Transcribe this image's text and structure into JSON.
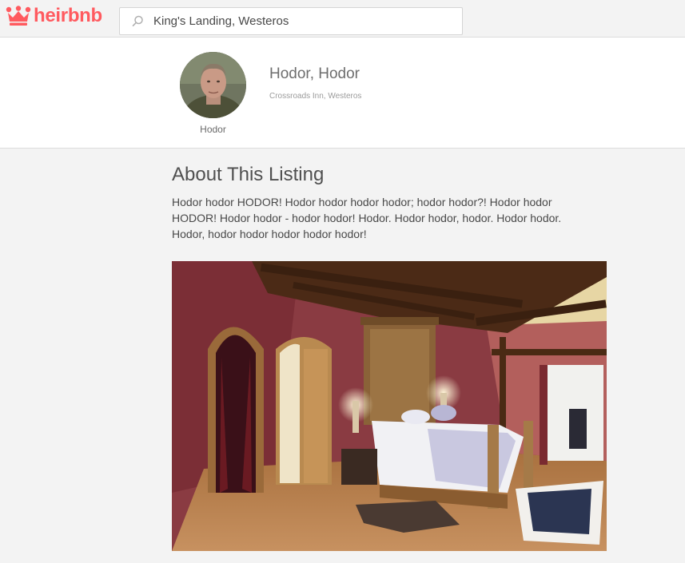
{
  "brand": {
    "name": "heirbnb",
    "color": "#ff5a5f"
  },
  "search": {
    "value": "King's Landing, Westeros",
    "icon": "search-icon"
  },
  "host": {
    "name": "Hodor",
    "avatar_icon": "avatar"
  },
  "listing": {
    "title": "Hodor, Hodor",
    "location": "Crossroads Inn, Westeros"
  },
  "about": {
    "heading": "About This Listing",
    "description": "Hodor hodor HODOR! Hodor hodor hodor hodor; hodor hodor?! Hodor hodor HODOR! Hodor hodor - hodor hodor! Hodor. Hodor hodor, hodor. Hodor hodor. Hodor, hodor hodor hodor hodor hodor!"
  }
}
